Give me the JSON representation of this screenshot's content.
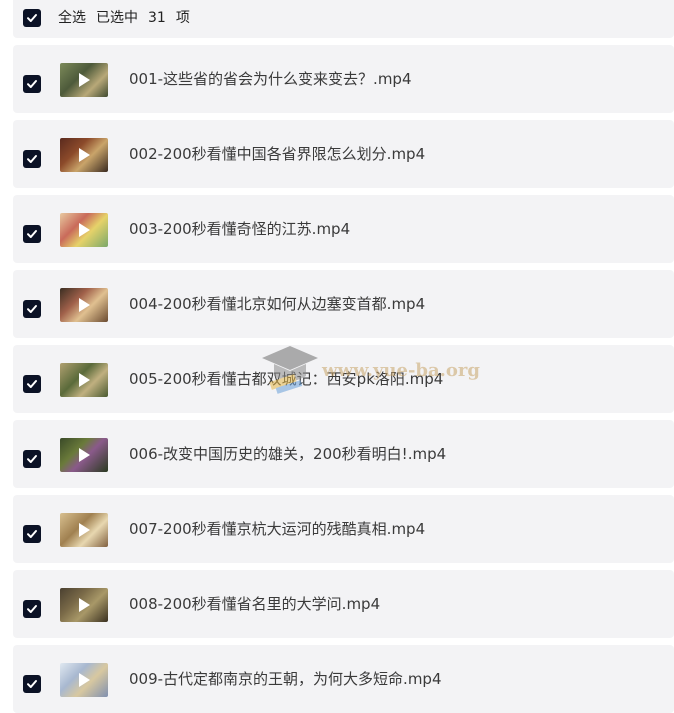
{
  "header": {
    "select_all": "全选",
    "selected_prefix": "已选中",
    "count": "31",
    "unit": "项"
  },
  "files": [
    {
      "name": "001-这些省的省会为什么变来变去？.mp4",
      "checked": true
    },
    {
      "name": "002-200秒看懂中国各省界限怎么划分.mp4",
      "checked": true
    },
    {
      "name": "003-200秒看懂奇怪的江苏.mp4",
      "checked": true
    },
    {
      "name": "004-200秒看懂北京如何从边塞变首都.mp4",
      "checked": true
    },
    {
      "name": "005-200秒看懂古都双城记：西安pk洛阳.mp4",
      "checked": true
    },
    {
      "name": "006-改变中国历史的雄关，200秒看明白!.mp4",
      "checked": true
    },
    {
      "name": "007-200秒看懂京杭大运河的残酷真相.mp4",
      "checked": true
    },
    {
      "name": "008-200秒看懂省名里的大学问.mp4",
      "checked": true
    },
    {
      "name": "009-古代定都南京的王朝，为何大多短命.mp4",
      "checked": true
    }
  ],
  "watermark": {
    "text": "www.yue-ba.org"
  },
  "colors": {
    "checkbox": "#0b1226",
    "row_bg": "#f3f3f5",
    "text": "#3a3a3a"
  }
}
